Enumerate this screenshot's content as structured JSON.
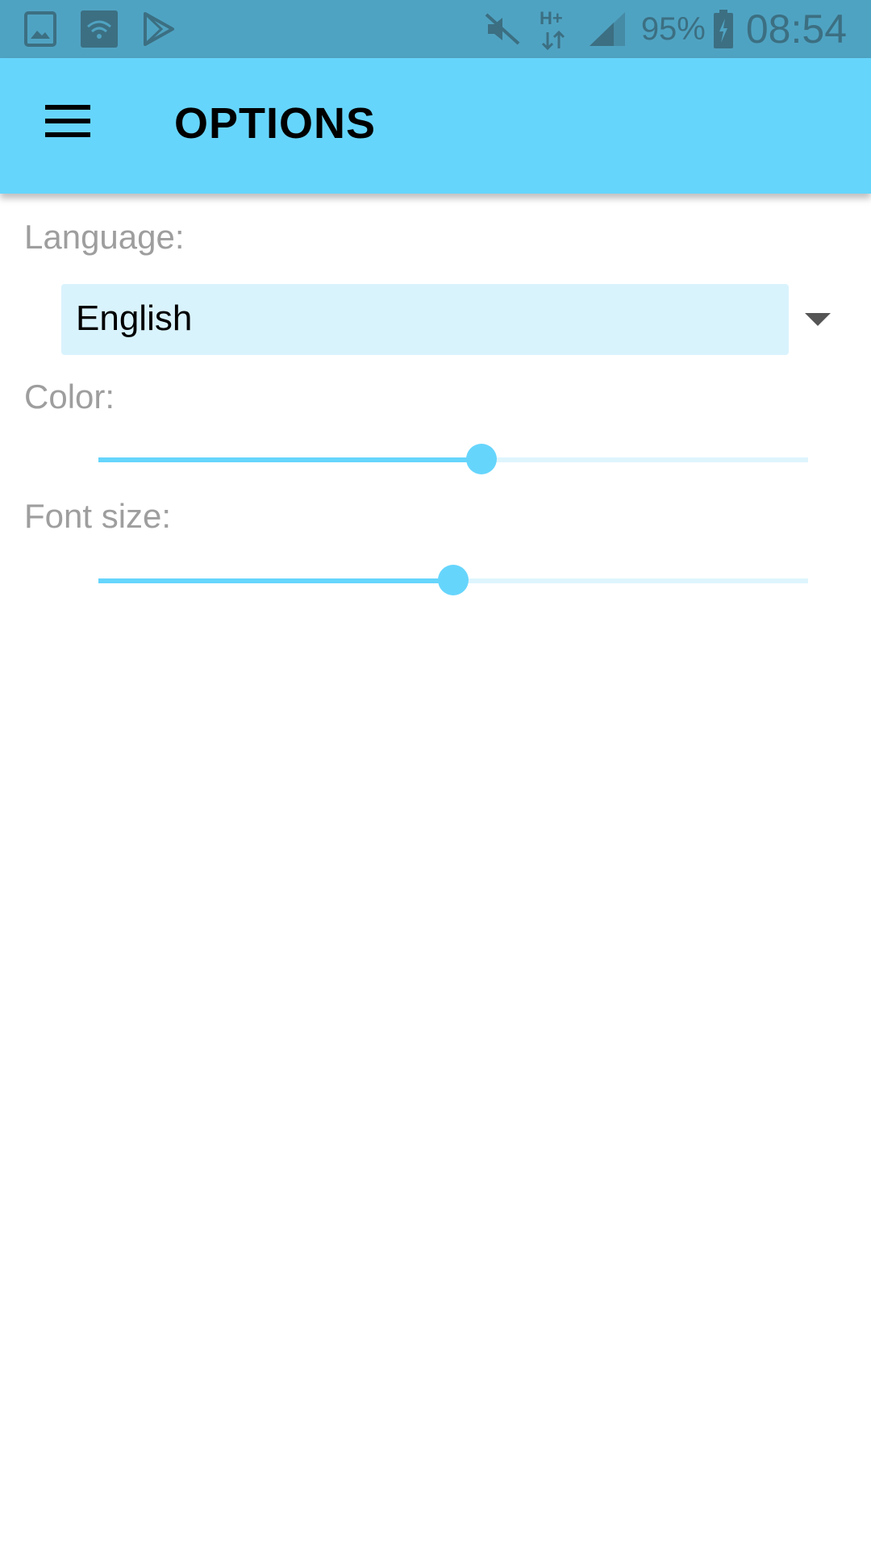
{
  "status_bar": {
    "left_icons": [
      "gallery-icon",
      "wifi-hotspot-icon",
      "play-store-icon"
    ],
    "right_icons": [
      "mute-icon",
      "network-hplus-icon",
      "signal-icon"
    ],
    "battery_percent": "95%",
    "time": "08:54"
  },
  "app_bar": {
    "menu_icon": "hamburger-menu-icon",
    "title": "OPTIONS",
    "color": "#66d5fc"
  },
  "options": {
    "language": {
      "label": "Language:",
      "selected": "English"
    },
    "color": {
      "label": "Color:",
      "value_fraction": 0.54
    },
    "font_size": {
      "label": "Font size:",
      "value_fraction": 0.5
    }
  }
}
